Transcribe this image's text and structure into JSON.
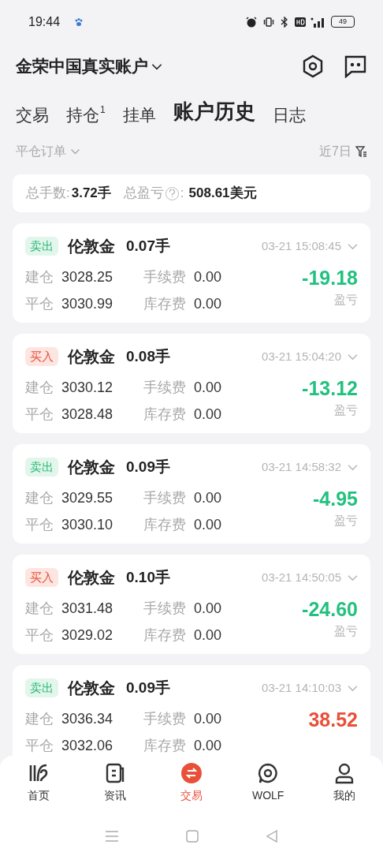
{
  "status_bar": {
    "time": "19:44",
    "battery": "49"
  },
  "header": {
    "account": "金荣中国真实账户"
  },
  "tabs": [
    {
      "label": "交易",
      "selected": false
    },
    {
      "label": "持仓",
      "badge": "1",
      "selected": false
    },
    {
      "label": "挂单",
      "selected": false
    },
    {
      "label": "账户历史",
      "selected": true
    },
    {
      "label": "日志",
      "selected": false
    }
  ],
  "filter": {
    "order_type": "平仓订单",
    "period": "近7日"
  },
  "summary": {
    "lots_label": "总手数:",
    "lots": "3.72手",
    "pnl_label": "总盈亏",
    "pnl_sep": ":",
    "pnl": "508.61美元"
  },
  "orders": [
    {
      "side": "卖出",
      "kind": "sell",
      "symbol": "伦敦金",
      "lots": "0.07手",
      "time": "03-21 15:08:45",
      "open_label": "建仓",
      "open": "3028.25",
      "close_label": "平仓",
      "close": "3030.99",
      "fee_label": "手续费",
      "fee": "0.00",
      "swap_label": "库存费",
      "swap": "0.00",
      "pnl": "-19.18",
      "pnl_label": "盈亏"
    },
    {
      "side": "买入",
      "kind": "buy",
      "symbol": "伦敦金",
      "lots": "0.08手",
      "time": "03-21 15:04:20",
      "open_label": "建仓",
      "open": "3030.12",
      "close_label": "平仓",
      "close": "3028.48",
      "fee_label": "手续费",
      "fee": "0.00",
      "swap_label": "库存费",
      "swap": "0.00",
      "pnl": "-13.12",
      "pnl_label": "盈亏"
    },
    {
      "side": "卖出",
      "kind": "sell",
      "symbol": "伦敦金",
      "lots": "0.09手",
      "time": "03-21 14:58:32",
      "open_label": "建仓",
      "open": "3029.55",
      "close_label": "平仓",
      "close": "3030.10",
      "fee_label": "手续费",
      "fee": "0.00",
      "swap_label": "库存费",
      "swap": "0.00",
      "pnl": "-4.95",
      "pnl_label": "盈亏"
    },
    {
      "side": "买入",
      "kind": "buy",
      "symbol": "伦敦金",
      "lots": "0.10手",
      "time": "03-21 14:50:05",
      "open_label": "建仓",
      "open": "3031.48",
      "close_label": "平仓",
      "close": "3029.02",
      "fee_label": "手续费",
      "fee": "0.00",
      "swap_label": "库存费",
      "swap": "0.00",
      "pnl": "-24.60",
      "pnl_label": "盈亏"
    },
    {
      "side": "卖出",
      "kind": "sell",
      "symbol": "伦敦金",
      "lots": "0.09手",
      "time": "03-21 14:10:03",
      "open_label": "建仓",
      "open": "3036.34",
      "close_label": "平仓",
      "close": "3032.06",
      "fee_label": "手续费",
      "fee": "0.00",
      "swap_label": "库存费",
      "swap": "0.00",
      "pnl": "38.52"
    }
  ],
  "bottom_nav": [
    {
      "label": "首页",
      "kind": "home",
      "selected": false
    },
    {
      "label": "资讯",
      "kind": "news",
      "selected": false
    },
    {
      "label": "交易",
      "kind": "trade",
      "selected": true
    },
    {
      "label": "WOLF",
      "kind": "wolf",
      "selected": false
    },
    {
      "label": "我的",
      "kind": "me",
      "selected": false
    }
  ]
}
